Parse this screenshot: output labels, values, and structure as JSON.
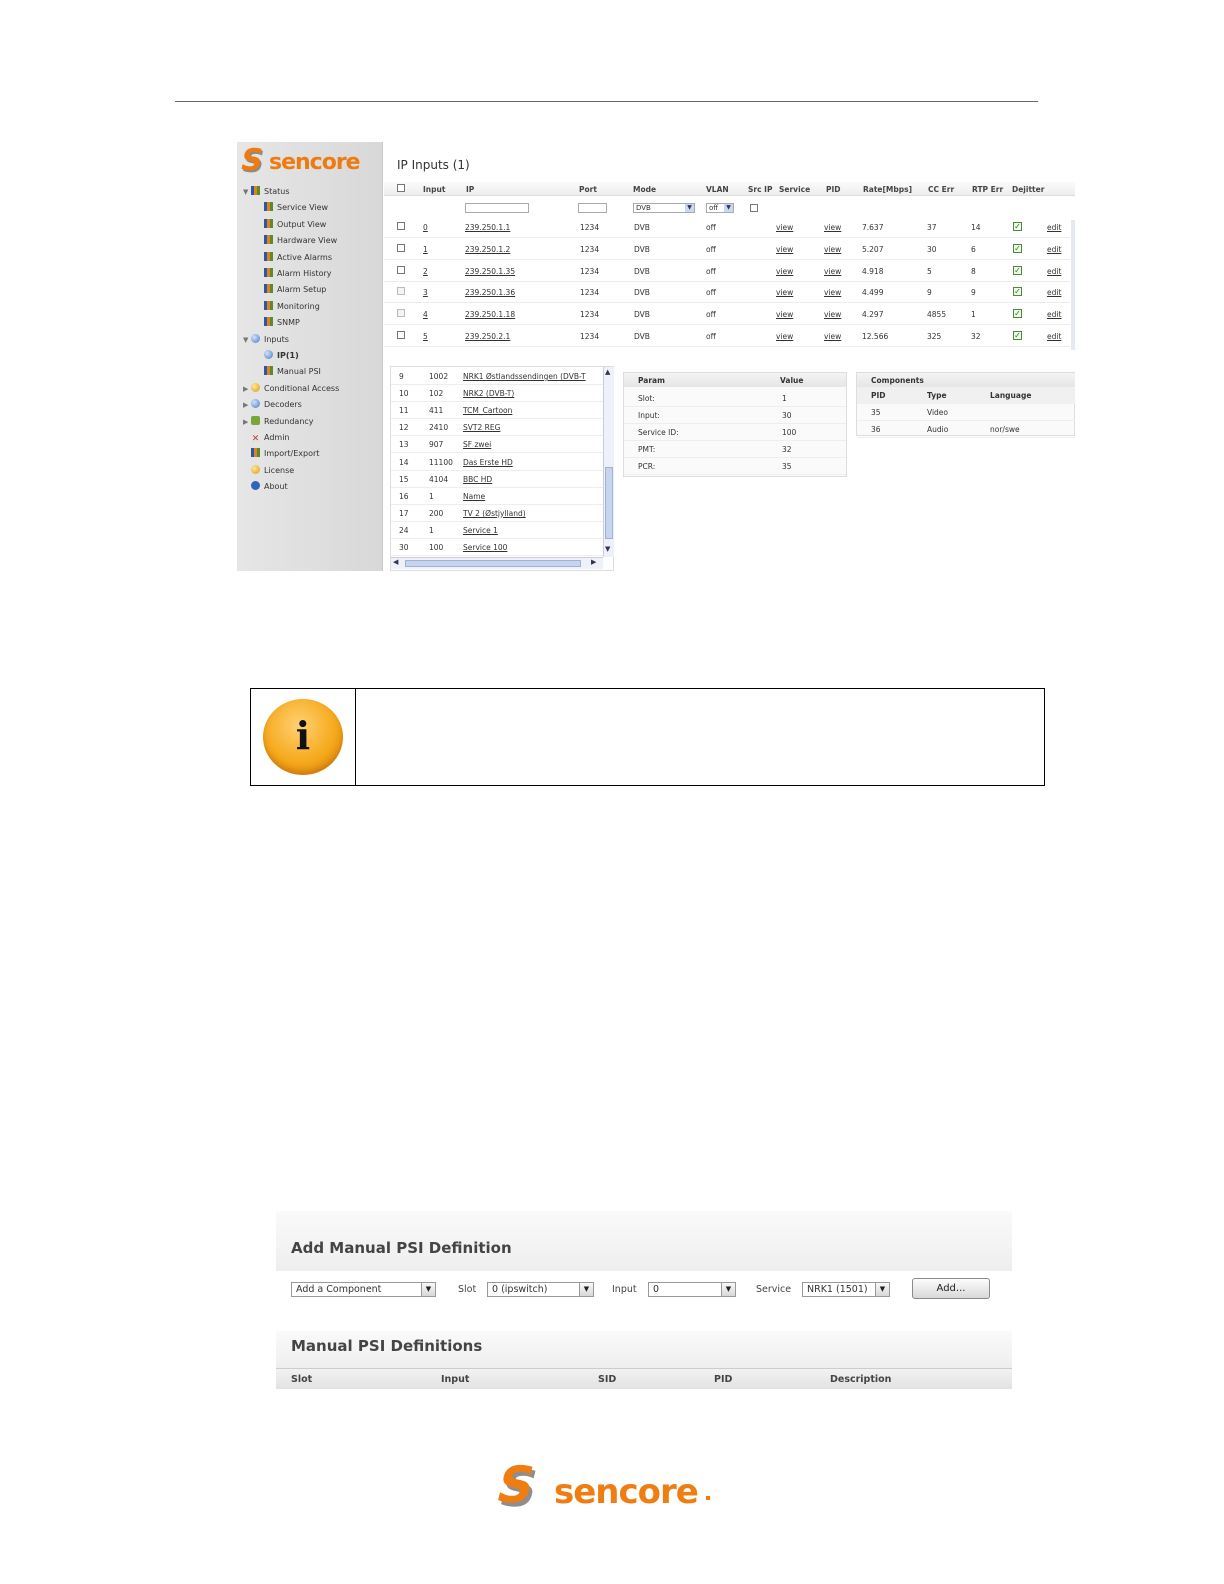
{
  "screenshot1": {
    "logo_text": "sencore",
    "sidebar": [
      {
        "label": "Status",
        "icon": "bar-chart-icon",
        "level": 0,
        "expand": "▼"
      },
      {
        "label": "Service View",
        "icon": "bar-chart-icon",
        "level": 1
      },
      {
        "label": "Output View",
        "icon": "bar-chart-icon",
        "level": 1
      },
      {
        "label": "Hardware View",
        "icon": "bar-chart-icon",
        "level": 1
      },
      {
        "label": "Active Alarms",
        "icon": "bar-chart-icon",
        "level": 1
      },
      {
        "label": "Alarm History",
        "icon": "bar-chart-icon",
        "level": 1
      },
      {
        "label": "Alarm Setup",
        "icon": "bar-chart-icon",
        "level": 1
      },
      {
        "label": "Monitoring",
        "icon": "bar-chart-icon",
        "level": 1
      },
      {
        "label": "SNMP",
        "icon": "bar-chart-icon",
        "level": 1
      },
      {
        "label": "Inputs",
        "icon": "globe-icon",
        "level": 0,
        "expand": "▼"
      },
      {
        "label": "IP(1)",
        "icon": "globe-icon",
        "level": 1,
        "bold": true
      },
      {
        "label": "Manual PSI",
        "icon": "bar-chart-icon",
        "level": 1
      },
      {
        "label": "Conditional Access",
        "icon": "lock-icon",
        "level": 0,
        "expand": "▶"
      },
      {
        "label": "Decoders",
        "icon": "globe-icon",
        "level": 0,
        "expand": "▶"
      },
      {
        "label": "Redundancy",
        "icon": "folder-icon",
        "level": 0,
        "expand": "▶"
      },
      {
        "label": "Admin",
        "icon": "tools-icon",
        "level": 0
      },
      {
        "label": "Import/Export",
        "icon": "import-icon",
        "level": 0
      },
      {
        "label": "License",
        "icon": "license-icon",
        "level": 0
      },
      {
        "label": "About",
        "icon": "info-icon",
        "level": 0
      }
    ],
    "title": "IP Inputs (1)",
    "columns": [
      "Input",
      "IP",
      "Port",
      "Mode",
      "VLAN",
      "Src IP",
      "Service",
      "PID",
      "Rate[Mbps]",
      "CC Err",
      "RTP Err",
      "Dejitter"
    ],
    "filters": {
      "mode": "DVB",
      "vlan": "off"
    },
    "rows": [
      {
        "input": "0",
        "ip": "239.250.1.1",
        "port": "1234",
        "mode": "DVB",
        "vlan": "off",
        "service": "view",
        "pid": "view",
        "rate": "7.637",
        "cc": "37",
        "rtp": "14",
        "edit": "edit"
      },
      {
        "input": "1",
        "ip": "239.250.1.2",
        "port": "1234",
        "mode": "DVB",
        "vlan": "off",
        "service": "view",
        "pid": "view",
        "rate": "5.207",
        "cc": "30",
        "rtp": "6",
        "edit": "edit"
      },
      {
        "input": "2",
        "ip": "239.250.1.35",
        "port": "1234",
        "mode": "DVB",
        "vlan": "off",
        "service": "view",
        "pid": "view",
        "rate": "4.918",
        "cc": "5",
        "rtp": "8",
        "edit": "edit"
      },
      {
        "input": "3",
        "ip": "239.250.1.36",
        "port": "1234",
        "mode": "DVB",
        "vlan": "off",
        "service": "view",
        "pid": "view",
        "rate": "4.499",
        "cc": "9",
        "rtp": "9",
        "edit": "edit"
      },
      {
        "input": "4",
        "ip": "239.250.1.18",
        "port": "1234",
        "mode": "DVB",
        "vlan": "off",
        "service": "view",
        "pid": "view",
        "rate": "4.297",
        "cc": "4855",
        "rtp": "1",
        "edit": "edit"
      },
      {
        "input": "5",
        "ip": "239.250.2.1",
        "port": "1234",
        "mode": "DVB",
        "vlan": "off",
        "service": "view",
        "pid": "view",
        "rate": "12.566",
        "cc": "325",
        "rtp": "32",
        "edit": "edit"
      }
    ],
    "services": [
      {
        "a": "9",
        "b": "1002",
        "name": "NRK1 Østlandssendingen (DVB-T"
      },
      {
        "a": "10",
        "b": "102",
        "name": "NRK2 (DVB-T)"
      },
      {
        "a": "11",
        "b": "411",
        "name": "TCM_Cartoon"
      },
      {
        "a": "12",
        "b": "2410",
        "name": "SVT2 REG"
      },
      {
        "a": "13",
        "b": "907",
        "name": "SF zwei"
      },
      {
        "a": "14",
        "b": "11100",
        "name": "Das Erste HD"
      },
      {
        "a": "15",
        "b": "4104",
        "name": "BBC HD"
      },
      {
        "a": "16",
        "b": "1",
        "name": "Name"
      },
      {
        "a": "17",
        "b": "200",
        "name": "TV 2 (Østjylland)"
      },
      {
        "a": "24",
        "b": "1",
        "name": "Service 1"
      },
      {
        "a": "30",
        "b": "100",
        "name": "Service 100"
      }
    ],
    "params": {
      "headers": [
        "Param",
        "Value"
      ],
      "rows": [
        {
          "k": "Slot:",
          "v": "1"
        },
        {
          "k": "Input:",
          "v": "30"
        },
        {
          "k": "Service ID:",
          "v": "100"
        },
        {
          "k": "PMT:",
          "v": "32"
        },
        {
          "k": "PCR:",
          "v": "35"
        }
      ]
    },
    "components": {
      "title": "Components",
      "headers": [
        "PID",
        "Type",
        "Language"
      ],
      "rows": [
        {
          "pid": "35",
          "type": "Video",
          "lang": ""
        },
        {
          "pid": "36",
          "type": "Audio",
          "lang": "nor/swe"
        }
      ]
    }
  },
  "info_icon_letter": "i",
  "screenshot2": {
    "add_title": "Add Manual PSI Definition",
    "component_select": "Add a Component",
    "slot_label": "Slot",
    "slot_value": "0 (ipswitch)",
    "input_label": "Input",
    "input_value": "0",
    "service_label": "Service",
    "service_value": "NRK1 (1501)",
    "add_button": "Add...",
    "list_title": "Manual PSI Definitions",
    "columns": [
      "Slot",
      "Input",
      "SID",
      "PID",
      "Description"
    ]
  },
  "footer_logo_text": "sencore",
  "colors": {
    "brand_orange": "#ee7b12",
    "check_green": "#2a7a1a"
  }
}
